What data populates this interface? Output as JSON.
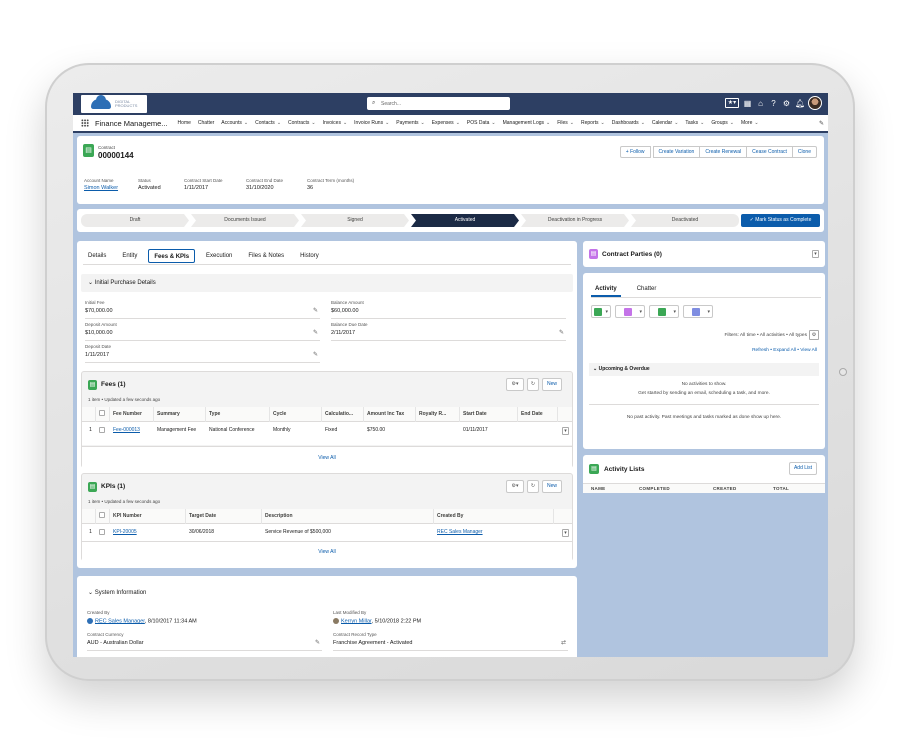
{
  "topbar": {
    "logo_text": "DIGITAL PRODUCTS",
    "search_placeholder": "Search...",
    "icons": [
      "favorites-icon",
      "apps-icon",
      "home-icon",
      "help-icon",
      "setup-icon",
      "notifications-icon",
      "avatar"
    ]
  },
  "nav": {
    "app_name": "Finance Manageme...",
    "items": [
      "Home",
      "Chatter",
      "Accounts",
      "Contacts",
      "Contracts",
      "Invoices",
      "Invoice Runs",
      "Payments",
      "Expenses",
      "POS Data",
      "Management Logs",
      "Files",
      "Reports",
      "Dashboards",
      "Calendar",
      "Tasks",
      "Groups",
      "More"
    ],
    "dropdown_items": [
      false,
      false,
      true,
      true,
      true,
      true,
      true,
      true,
      true,
      true,
      true,
      true,
      true,
      true,
      true,
      true,
      true,
      true
    ]
  },
  "record": {
    "object_type": "Contract",
    "number": "00000144",
    "buttons": [
      "+ Follow",
      "Create Variation",
      "Create Renewal",
      "Cease Contract",
      "Clone"
    ],
    "fields": [
      {
        "label": "Account Name",
        "value": "Simon Walker",
        "link": true
      },
      {
        "label": "Status",
        "value": "Activated",
        "link": false
      },
      {
        "label": "Contract Start Date",
        "value": "1/11/2017",
        "link": false
      },
      {
        "label": "Contract End Date",
        "value": "31/10/2020",
        "link": false
      },
      {
        "label": "Contract Term (months)",
        "value": "36",
        "link": false
      }
    ]
  },
  "path": {
    "stages": [
      "Draft",
      "Documents Issued",
      "Signed",
      "Activated",
      "Deactivation in Progress",
      "Deactivated"
    ],
    "active_index": 3,
    "mark_button": "✓ Mark Status as Complete"
  },
  "tabs": [
    "Details",
    "Entity",
    "Fees & KPIs",
    "Execution",
    "Files & Notes",
    "History"
  ],
  "initial_purchase": {
    "title": "Initial Purchase Details",
    "fields": [
      {
        "label": "Initial Fee",
        "value": "$70,000.00"
      },
      {
        "label": "Balance Amount",
        "value": "$60,000.00"
      },
      {
        "label": "Deposit Amount",
        "value": "$10,000.00"
      },
      {
        "label": "Balance Due Date",
        "value": "2/11/2017"
      },
      {
        "label": "Deposit Date",
        "value": "1/11/2017"
      }
    ]
  },
  "fees": {
    "title": "Fees (1)",
    "subtitle": "1 item • Updated a few seconds ago",
    "new_label": "New",
    "columns": [
      "Fee Number",
      "Summary",
      "Type",
      "Cycle",
      "Calculatio...",
      "Amount Inc Tax",
      "Royalty R...",
      "Start Date",
      "End Date"
    ],
    "rows": [
      {
        "num": "1",
        "cells": [
          "Fee-000013",
          "Management Fee",
          "National Conference",
          "Monthly",
          "Fixed",
          "$750.00",
          "",
          "01/11/2017",
          ""
        ]
      }
    ],
    "view_all": "View All"
  },
  "kpis": {
    "title": "KPIs (1)",
    "subtitle": "1 item • Updated a few seconds ago",
    "new_label": "New",
    "columns": [
      "KPI Number",
      "Target Date",
      "Description",
      "Created By"
    ],
    "rows": [
      {
        "num": "1",
        "cells": [
          "KPI-20005",
          "30/06/2018",
          "Service Revenue of $500,000",
          "REC Sales Manager"
        ]
      }
    ],
    "view_all": "View All"
  },
  "system_info": {
    "title": "System Information",
    "fields": [
      {
        "label": "Created By",
        "user": "REC Sales Manager",
        "date": ", 8/10/2017 11:34 AM"
      },
      {
        "label": "Last Modified By",
        "user": "Kerryn Millar",
        "date": ", 5/10/2018 2:22 PM"
      },
      {
        "label": "Contract Currency",
        "value": "AUD - Australian Dollar"
      },
      {
        "label": "Contract Record Type",
        "value": "Franchise Agreement - Activated"
      }
    ]
  },
  "contract_parties": {
    "title": "Contract Parties (0)"
  },
  "activity": {
    "tabs": [
      "Activity",
      "Chatter"
    ],
    "filters": "Filters: All time • All activities • All types",
    "links": [
      "Refresh",
      "Expand All",
      "View All"
    ],
    "upcoming_title": "Upcoming & Overdue",
    "no_activities": "No activities to show.",
    "get_started": "Get started by sending an email, scheduling a task, and more.",
    "no_past": "No past activity. Past meetings and tasks marked as done show up here.",
    "icon_colors": [
      "#3ba755",
      "#c473e8",
      "#3ba755",
      "#7f8de1"
    ]
  },
  "activity_lists": {
    "title": "Activity Lists",
    "button": "Add List",
    "columns": [
      "NAME",
      "COMPLETED",
      "CREATED",
      "TOTAL"
    ]
  }
}
